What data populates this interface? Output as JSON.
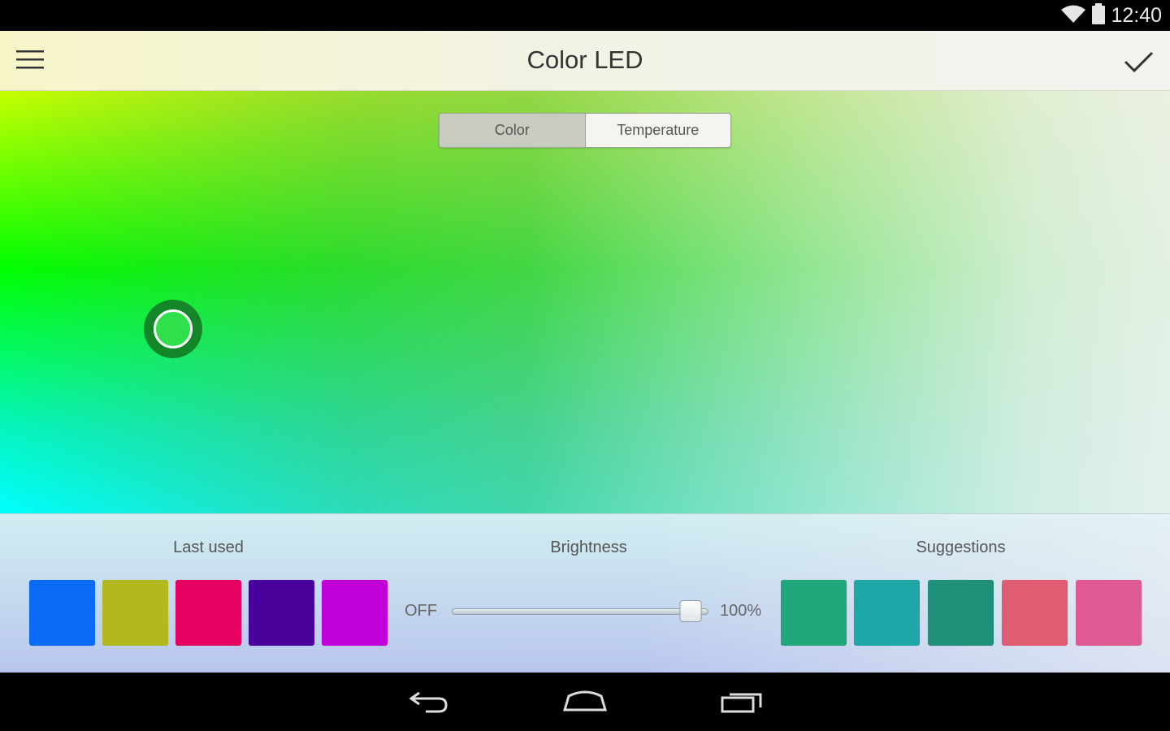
{
  "status_bar": {
    "time": "12:40",
    "wifi_icon": "wifi-icon",
    "battery_icon": "battery-icon"
  },
  "app_bar": {
    "title": "Color LED",
    "menu_icon": "hamburger-menu-icon",
    "confirm_icon": "checkmark-icon"
  },
  "mode_tabs": {
    "selected": "Color",
    "tabs": [
      {
        "label": "Color"
      },
      {
        "label": "Temperature"
      }
    ]
  },
  "colors": {
    "selected_handle": "#2fe04a",
    "handle_ring": "#14862a"
  },
  "last_used": {
    "label": "Last used",
    "swatches": [
      "#0a6cf5",
      "#b2b91e",
      "#e6005f",
      "#4a029d",
      "#c100d8"
    ]
  },
  "brightness": {
    "label": "Brightness",
    "min_label": "OFF",
    "max_label": "100%",
    "value_fraction": 1.0
  },
  "suggestions": {
    "label": "Suggestions",
    "swatches": [
      "#22a77a",
      "#1fa6a6",
      "#21907b",
      "#e05c72",
      "#dd5a92"
    ]
  },
  "nav_bar": {
    "back_icon": "back-icon",
    "home_icon": "home-icon",
    "recents_icon": "recent-apps-icon"
  }
}
